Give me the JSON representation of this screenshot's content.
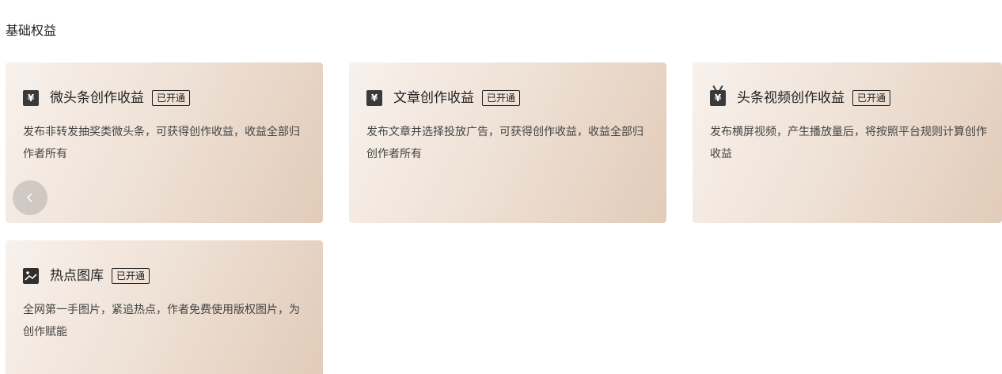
{
  "section": {
    "title": "基础权益"
  },
  "cards": [
    {
      "title": "微头条创作收益",
      "badge": "已开通",
      "icon_glyph": "¥",
      "icon": "yuan-icon",
      "desc": "发布非转发抽奖类微头条，可获得创作收益，收益全部归作者所有"
    },
    {
      "title": "文章创作收益",
      "badge": "已开通",
      "icon_glyph": "¥",
      "icon": "yuan-icon",
      "desc": "发布文章并选择投放广告，可获得创作收益，收益全部归创作者所有"
    },
    {
      "title": "头条视频创作收益",
      "badge": "已开通",
      "icon_glyph": "¥",
      "icon": "tv-yuan-icon",
      "desc": "发布横屏视频，产生播放量后，将按照平台规则计算创作收益"
    },
    {
      "title": "热点图库",
      "badge": "已开通",
      "icon": "image-icon",
      "desc": "全网第一手图片，紧追热点，作者免费使用版权图片，为创作赋能"
    }
  ],
  "carousel": {
    "prev_icon": "chevron-left-icon"
  },
  "colors": {
    "card_gradient_start": "#f8f1ec",
    "card_gradient_end": "#e2cbb9",
    "icon_bg": "#3a3a3a",
    "text_primary": "#222222",
    "text_secondary": "#444444"
  }
}
